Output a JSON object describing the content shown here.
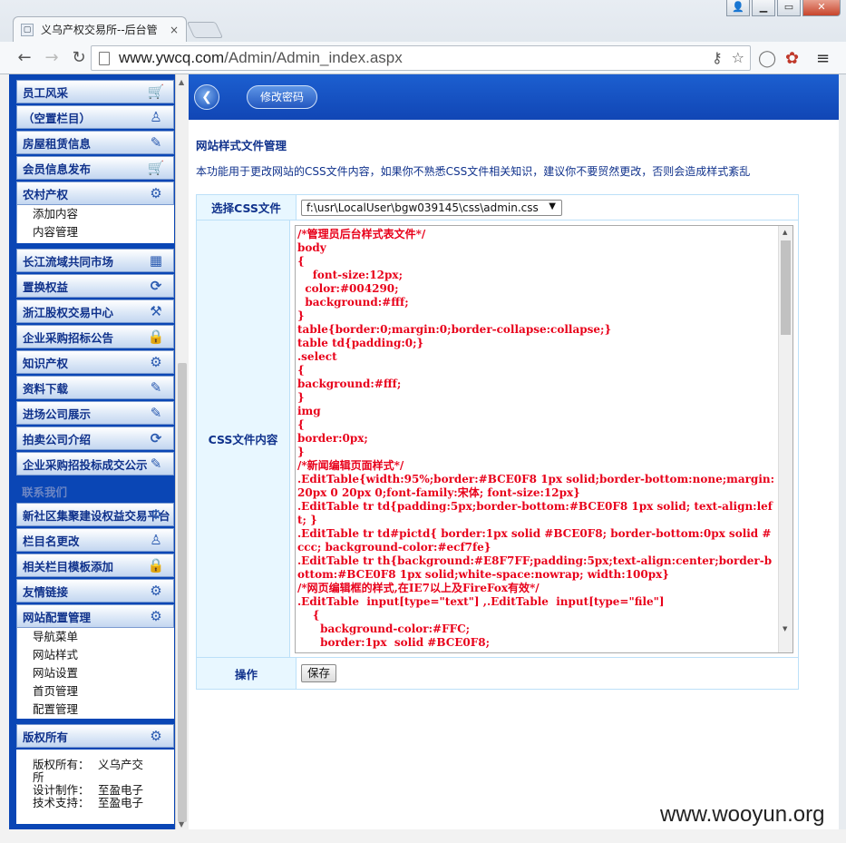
{
  "browser": {
    "tab_title": "义乌产权交易所--后台管",
    "tab_close": "×",
    "url_host": "www.ywcq.com",
    "url_path": "/Admin/Admin_index.aspx"
  },
  "sidebar": {
    "items": [
      {
        "label": "员工风采",
        "icon": "cart-icon"
      },
      {
        "label": "（空置栏目）",
        "icon": "person-icon"
      },
      {
        "label": "房屋租赁信息",
        "icon": "edit-icon"
      },
      {
        "label": "会员信息发布",
        "icon": "cart-icon"
      },
      {
        "label": "农村产权",
        "icon": "gear-icon"
      }
    ],
    "sub1": [
      "添加内容",
      "内容管理"
    ],
    "items2": [
      {
        "label": "长江流域共同市场",
        "icon": "picture-icon"
      },
      {
        "label": "置换权益",
        "icon": "refresh-icon"
      },
      {
        "label": "浙江股权交易中心",
        "icon": "tools-icon"
      },
      {
        "label": "企业采购招标公告",
        "icon": "lock-icon"
      },
      {
        "label": "知识产权",
        "icon": "gear-icon"
      },
      {
        "label": "资料下载",
        "icon": "edit-icon"
      },
      {
        "label": "进场公司展示",
        "icon": "edit-icon"
      },
      {
        "label": "拍卖公司介绍",
        "icon": "refresh-icon"
      },
      {
        "label": "企业采购招投标成交公示",
        "icon": "edit-icon"
      }
    ],
    "gray_label": "联系我们",
    "items3": [
      {
        "label": "新社区集聚建设权益交易平台",
        "icon": "settings-icon"
      },
      {
        "label": "栏目名更改",
        "icon": "person-icon"
      },
      {
        "label": "相关栏目模板添加",
        "icon": "lock-icon"
      },
      {
        "label": "友情链接",
        "icon": "settings-icon"
      },
      {
        "label": "网站配置管理",
        "icon": "settings-icon"
      }
    ],
    "sub2": [
      "导航菜单",
      "网站样式",
      "网站设置",
      "首页管理",
      "配置管理"
    ],
    "copyright_header": "版权所有",
    "copyright": [
      {
        "k": "版权所有：",
        "v": "义乌产交"
      },
      {
        "k": "所",
        "v": ""
      },
      {
        "k": "设计制作：",
        "v": "至盈电子"
      },
      {
        "k": "技术支持：",
        "v": "至盈电子"
      }
    ]
  },
  "main": {
    "change_password": "修改密码",
    "heading": "网站样式文件管理",
    "description": "本功能用于更改网站的CSS文件内容，如果你不熟悉CSS文件相关知识，建议你不要贸然更改，否则会造成样式紊乱",
    "select_label": "选择CSS文件",
    "select_value": "f:\\usr\\LocalUser\\bgw039145\\css\\admin.css",
    "content_label": "CSS文件内容",
    "css_content": "/*管理员后台样式表文件*/\nbody\n{\n    font-size:12px;\n  color:#004290;\n  background:#fff;\n}\ntable{border:0;margin:0;border-collapse:collapse;}\ntable td{padding:0;}\n.select\n{\nbackground:#fff;\n}\nimg\n{\nborder:0px;\n}\n/*新闻编辑页面样式*/\n.EditTable{width:95%;border:#BCE0F8 1px solid;border-bottom:none;margin:20px 0 20px 0;font-family:宋体; font-size:12px}\n.EditTable tr td{padding:5px;border-bottom:#BCE0F8 1px solid; text-align:left; }\n.EditTable tr td#pictd{ border:1px solid #BCE0F8; border-bottom:0px solid #ccc; background-color:#ecf7fe}\n.EditTable tr th{background:#E8F7FF;padding:5px;text-align:center;border-bottom:#BCE0F8 1px solid;white-space:nowrap; width:100px}\n/*网页编辑框的样式,在IE7以上及FireFox有效*/\n.EditTable  input[type=\"text\"] ,.EditTable  input[type=\"file\"]\n    {\n      background-color:#FFC;\n      border:1px  solid #BCE0F8;",
    "op_label": "操作",
    "save": "保存"
  },
  "watermark": "www.wooyun.org"
}
